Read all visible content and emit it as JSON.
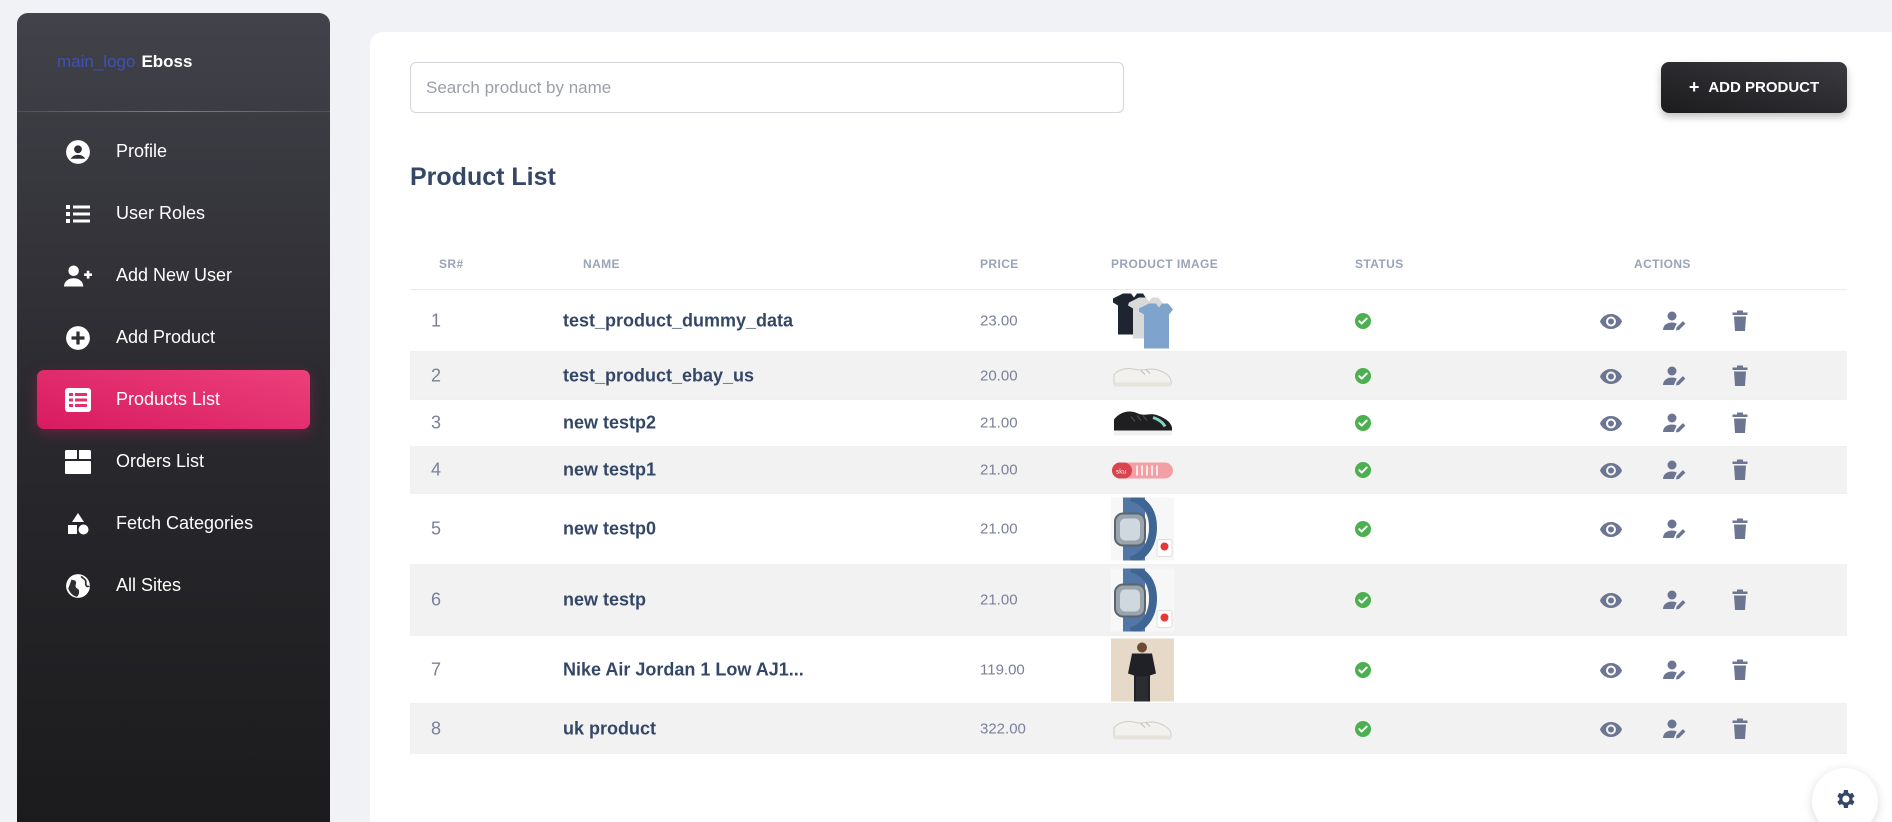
{
  "brand": {
    "logo_alt": "main_logo",
    "name": "Eboss"
  },
  "sidebar": {
    "items": [
      {
        "label": "Profile",
        "icon": "profile-icon"
      },
      {
        "label": "User Roles",
        "icon": "list-icon"
      },
      {
        "label": "Add New User",
        "icon": "person-add-icon"
      },
      {
        "label": "Add Product",
        "icon": "add-circle-icon"
      },
      {
        "label": "Products List",
        "icon": "list-alt-icon",
        "active": true
      },
      {
        "label": "Orders List",
        "icon": "box-icon"
      },
      {
        "label": "Fetch Categories",
        "icon": "category-icon"
      },
      {
        "label": "All Sites",
        "icon": "globe-icon"
      }
    ]
  },
  "search": {
    "placeholder": "Search product by name",
    "value": ""
  },
  "toolbar": {
    "add_product_label": "ADD PRODUCT"
  },
  "page": {
    "title": "Product List"
  },
  "table": {
    "columns": {
      "sr": "SR#",
      "name": "NAME",
      "price": "PRICE",
      "image": "PRODUCT IMAGE",
      "status": "STATUS",
      "actions": "ACTIONS"
    },
    "rows": [
      {
        "sr": "1",
        "name": "test_product_dummy_data",
        "price": "23.00",
        "image": "tshirts",
        "status": "active"
      },
      {
        "sr": "2",
        "name": "test_product_ebay_us",
        "price": "20.00",
        "image": "white-sneaker",
        "status": "active"
      },
      {
        "sr": "3",
        "name": "new testp2",
        "price": "21.00",
        "image": "black-sneaker",
        "status": "active"
      },
      {
        "sr": "4",
        "name": "new testp1",
        "price": "21.00",
        "image": "pink-sneaker",
        "status": "active"
      },
      {
        "sr": "5",
        "name": "new testp0",
        "price": "21.00",
        "image": "smartwatch",
        "status": "active"
      },
      {
        "sr": "6",
        "name": "new testp",
        "price": "21.00",
        "image": "smartwatch",
        "status": "active"
      },
      {
        "sr": "7",
        "name": "Nike Air Jordan 1 Low AJ1...",
        "price": "119.00",
        "image": "person-hoodie",
        "status": "active"
      },
      {
        "sr": "8",
        "name": "uk product",
        "price": "322.00",
        "image": "white-sneaker",
        "status": "active"
      }
    ]
  },
  "colors": {
    "accent": "#e91e63",
    "heading": "#344767",
    "status_ok": "#4caf50",
    "action_icon": "#6c7592"
  }
}
